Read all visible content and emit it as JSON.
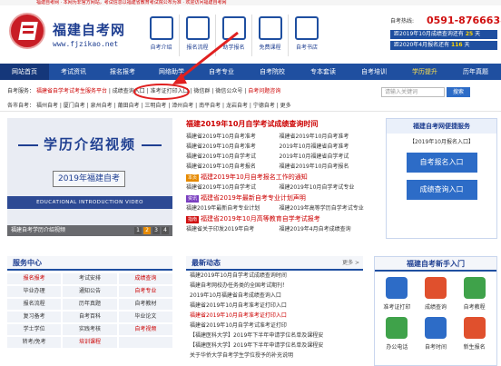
{
  "topstrip": "福建自考网 · 本网为非官方网站，考试信息以福建省教育考试院公布为准 · 欢迎访问福建自考网",
  "brand": {
    "name": "福建自考网",
    "url": "www.fjzikao.net"
  },
  "quick_links": [
    "自考介绍",
    "报名流程",
    "助学报名",
    "免费课程",
    "自考书店"
  ],
  "hotline": {
    "label": "自考热线:",
    "number": "0591-87666380",
    "countdown1_prefix": "距2019年10月成绩查询还有",
    "countdown1_days": "25",
    "countdown1_suffix": "天",
    "countdown2_prefix": "距2020年4月报名还有",
    "countdown2_days": "116",
    "countdown2_suffix": "天"
  },
  "nav": [
    "网站首页",
    "考试资讯",
    "报名报考",
    "网络助学",
    "自考专业",
    "自考院校",
    "专本套读",
    "自考培训",
    "学历提升",
    "历年真题"
  ],
  "sub1": {
    "prefix": "自考服务：",
    "hot": "福建省自学考试考生服务平台",
    "links": [
      "成绩查询入口",
      "准考证打印入口",
      "微信群",
      "微信公众号"
    ],
    "red": "自考问题咨询"
  },
  "search": {
    "placeholder": "请输入关键词",
    "button": "搜索"
  },
  "sub2": {
    "prefix": "各市自考：",
    "cities": [
      "福州自考",
      "厦门自考",
      "泉州自考",
      "莆田自考",
      "三明自考",
      "漳州自考",
      "南平自考",
      "龙岩自考",
      "宁德自考",
      "更多"
    ]
  },
  "banner": {
    "title": "学历介绍视频",
    "year": "2019年福建自考",
    "english": "EDUCATIONAL INTRODUCTION VIDEO",
    "caption": "福建自考学历介绍视频",
    "pages": [
      "1",
      "2",
      "3",
      "4"
    ]
  },
  "news": {
    "headline": "福建2019年10月自学考试成绩查询时间",
    "rows1": [
      [
        "福建省2019年10月自考准考",
        "福建省2019年10月自考准考"
      ],
      [
        "福建省2019年10月自考准考",
        "2019年10月福建省自考准考"
      ],
      [
        "福建省2019年10月自学考试",
        "2019年10月福建省自学考试"
      ],
      [
        "福建省2019年10月自考报名",
        "福建省2019年10月自考报名"
      ]
    ],
    "tag1": "本页",
    "big1": "福建2019年10月自考报名工作的通知",
    "rows2": [
      [
        "福建省2019年10月自学考试",
        "福建2019年10月自学考试专业"
      ]
    ],
    "tag2": "资讯",
    "big2": "福建省2019年最新自考专业计划声明",
    "rows3": [
      [
        "福建2019年最新自考专业计划",
        "福建2019年高等学历自学考试专业"
      ]
    ],
    "tag3": "指南",
    "big3": "福建省2019年10月高等教育自学考试报考",
    "rows4": [
      [
        "福建省关于印发2019年自考",
        "福建2019年4月自考成绩查询"
      ]
    ]
  },
  "service": {
    "title": "福建自考网便捷服务",
    "sub": "【2019年10月报名入口】",
    "btn1": "自考报名入口",
    "btn2": "成绩查询入口"
  },
  "center": {
    "title": "服务中心",
    "cells": [
      {
        "t": "报名报考",
        "red": true
      },
      {
        "t": "考试安排",
        "red": false
      },
      {
        "t": "成绩查询",
        "red": true
      },
      {
        "t": "毕业办理",
        "red": false
      },
      {
        "t": "通知公告",
        "red": false
      },
      {
        "t": "自考专业",
        "red": true
      },
      {
        "t": "报名流程",
        "red": false
      },
      {
        "t": "历年真题",
        "red": false
      },
      {
        "t": "自考教材",
        "red": false
      },
      {
        "t": "复习备考",
        "red": false
      },
      {
        "t": "自考百科",
        "red": false
      },
      {
        "t": "毕业论文",
        "red": false
      },
      {
        "t": "学士学位",
        "red": false
      },
      {
        "t": "实践考核",
        "red": false
      },
      {
        "t": "自考视频",
        "red": true
      },
      {
        "t": "转考/免考",
        "red": false
      },
      {
        "t": "培训课程",
        "red": true
      },
      {
        "t": "",
        "red": false
      }
    ]
  },
  "latest": {
    "title": "最新动态",
    "more": "更多 >",
    "items": [
      {
        "t": "福建2019年10月自学考试成绩查询时间",
        "red": false
      },
      {
        "t": "福建自考网校办任务类的全国考试期刊！",
        "red": false
      },
      {
        "t": "2019年10月福建省自考成绩查询入口",
        "red": false
      },
      {
        "t": "福建省2019年10月自考准考证打印入口",
        "red": false
      },
      {
        "t": "福建省2019年10月自考准考证打印入口",
        "red": true
      },
      {
        "t": "福建省2019年10月自学考试准考证打印",
        "red": false
      },
      {
        "t": "【福建医科大学】2019年下半年申请学位名单及课程安",
        "red": false
      },
      {
        "t": "【福建医科大学】2019年下半年申请学位名单及课程安",
        "red": false
      },
      {
        "t": "关于华侨大学自考学生学位授予的补充说明",
        "red": false
      }
    ]
  },
  "newbie": {
    "title": "福建自考新手入门",
    "icons": [
      {
        "label": "准考证打印",
        "color": "#2d6cc7"
      },
      {
        "label": "成绩查询",
        "color": "#e0502d"
      },
      {
        "label": "自考教程",
        "color": "#3fa24a"
      },
      {
        "label": "办公电话",
        "color": "#3fa24a"
      },
      {
        "label": "自考时间",
        "color": "#2d6cc7"
      },
      {
        "label": "新生报名",
        "color": "#e0502d"
      }
    ]
  }
}
